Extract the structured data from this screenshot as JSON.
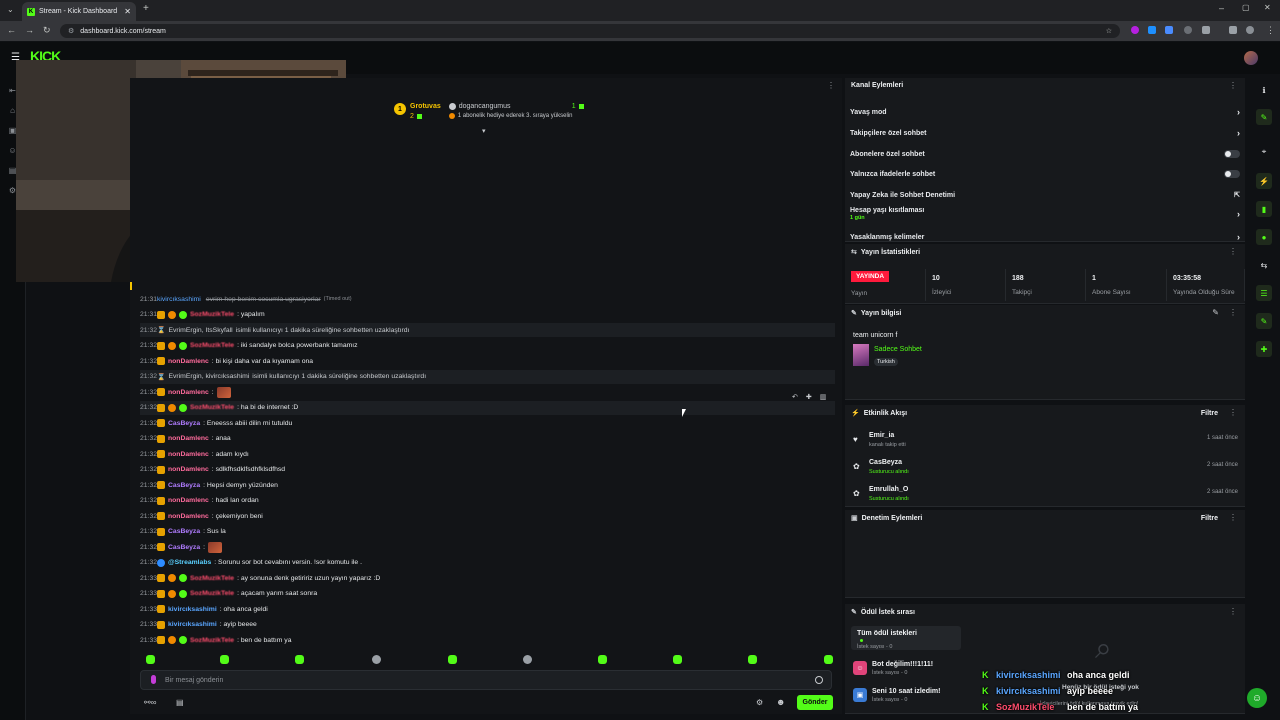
{
  "browser": {
    "tab_title": "Stream - Kick Dashboard",
    "url": "dashboard.kick.com/stream"
  },
  "app": {
    "logo": "KICK"
  },
  "top_chatter": {
    "rank": "1",
    "name": "Grotuvas",
    "count": "2",
    "second_name": "dogancangumus",
    "second_count": "1",
    "note": "1 abonelik hediye ederek 3. sıraya yükselin"
  },
  "chat": {
    "messages": [
      {
        "time": "21:31",
        "user": "kivircıksashimi",
        "text": "evrim hep benim cocumla ugrasiyorlar",
        "suffix": "(Timed out)",
        "kind": "struck"
      },
      {
        "time": "21:31",
        "user": "SozMuzikTele",
        "text": ": yapalım",
        "kind": "msg"
      },
      {
        "time": "21:32",
        "user": "EvrimErgin, ItsSkyfall",
        "text": " isimli kullanıcıyı 1 dakika süreliğine sohbetten uzaklaştırdı",
        "kind": "sys"
      },
      {
        "time": "21:32",
        "user": "SozMuzikTele",
        "text": ": iki sandalye bolca powerbank tamamız",
        "kind": "msg"
      },
      {
        "time": "21:32",
        "user": "nonDamlenc",
        "text": ": bi kişi daha var da kıyamam ona",
        "kind": "msg"
      },
      {
        "time": "21:32",
        "user": "EvrimErgin, kivircıksashimi",
        "text": " isimli kullanıcıyı 1 dakika süreliğine sohbetten uzaklaştırdı",
        "kind": "sys"
      },
      {
        "time": "21:32",
        "user": "nonDamlenc",
        "text": ":",
        "kind": "emote"
      },
      {
        "time": "21:32",
        "user": "SozMuzikTele",
        "text": ": ha bi de internet :D",
        "kind": "msg"
      },
      {
        "time": "21:32",
        "user": "CasBeyza",
        "text": ": Eneesss abiii dilin mi tutuldu",
        "kind": "msg"
      },
      {
        "time": "21:32",
        "user": "nonDamlenc",
        "text": ": anaa",
        "kind": "msg"
      },
      {
        "time": "21:32",
        "user": "nonDamlenc",
        "text": ": adam kıydı",
        "kind": "msg"
      },
      {
        "time": "21:32",
        "user": "nonDamlenc",
        "text": ": sdlkfhsdklfsdhfklsdfhsd",
        "kind": "msg"
      },
      {
        "time": "21:32",
        "user": "CasBeyza",
        "text": ": Hepsi demyn yüzünden",
        "kind": "msg"
      },
      {
        "time": "21:32",
        "user": "nonDamlenc",
        "text": ": hadi lan ordan",
        "kind": "msg"
      },
      {
        "time": "21:32",
        "user": "nonDamlenc",
        "text": ": çekemiyon beni",
        "kind": "msg"
      },
      {
        "time": "21:32",
        "user": "CasBeyza",
        "text": ": Sus la",
        "kind": "msg"
      },
      {
        "time": "21:32",
        "user": "CasBeyza",
        "text": ":",
        "kind": "emote"
      },
      {
        "time": "21:32",
        "user": "@Streamlabs",
        "text": ": Sorunu sor bot cevabını versin. !sor komutu ile .",
        "kind": "msg"
      },
      {
        "time": "21:33",
        "user": "SozMuzikTele",
        "text": ": ay sonuna denk getiririz uzun yayın yaparız :D",
        "kind": "msg"
      },
      {
        "time": "21:33",
        "user": "SozMuzikTele",
        "text": ": açacam yarım saat sonra",
        "kind": "msg"
      },
      {
        "time": "21:33",
        "user": "kivircıksashimi",
        "text": ": oha anca geldi",
        "kind": "msg"
      },
      {
        "time": "21:33",
        "user": "kivircıksashimi",
        "text": ": ayip beeee",
        "kind": "msg"
      },
      {
        "time": "21:33",
        "user": "SozMuzikTele",
        "text": ": ben de battım ya",
        "kind": "msg"
      }
    ],
    "input_placeholder": "Bir mesaj gönderin",
    "send_label": "Gönder"
  },
  "channel_actions": {
    "title": "Kanal Eylemleri",
    "items": [
      {
        "label": "Yavaş mod",
        "control": "chevron"
      },
      {
        "label": "Takipçilere özel sohbet",
        "control": "chevron"
      },
      {
        "label": "Abonelere özel sohbet",
        "control": "toggle"
      },
      {
        "label": "Yalnızca ifadelerle sohbet",
        "control": "toggle"
      },
      {
        "label": "Yapay Zeka ile Sohbet Denetimi",
        "control": "external"
      },
      {
        "label": "Hesap yaşı kısıtlaması",
        "sub": "1 gün",
        "control": "chevron"
      },
      {
        "label": "Yasaklanmış kelimeler",
        "control": "chevron"
      }
    ]
  },
  "stream_stats": {
    "title": "Yayın İstatistikleri",
    "live_badge": "YAYINDA",
    "items": [
      {
        "label": "Yayın",
        "value": ""
      },
      {
        "label": "İzleyici",
        "value": "10"
      },
      {
        "label": "Takipçi",
        "value": "188"
      },
      {
        "label": "Abone Sayısı",
        "value": "1"
      },
      {
        "label": "Yayında Olduğu Süre",
        "value": "03:35:58"
      }
    ]
  },
  "stream_info": {
    "title": "Yayın bilgisi",
    "stream_title": "team unicorn f",
    "category": "Sadece Sohbet",
    "language": "Turkish"
  },
  "activity_feed": {
    "title": "Etkinlik Akışı",
    "filter_label": "Filtre",
    "items": [
      {
        "name": "Emir_ia",
        "detail": "kanalı takip etti",
        "time": "1 saat önce",
        "icon": "heart-icon"
      },
      {
        "name": "CasBeyza",
        "detail": "Susturucu alındı",
        "time": "2 saat önce",
        "icon": "gift-icon"
      },
      {
        "name": "Emrullah_O",
        "detail": "Susturucu alındı",
        "time": "2 saat önce",
        "icon": "gift-icon"
      }
    ]
  },
  "mod_actions": {
    "title": "Denetim Eylemleri",
    "filter_label": "Filtre"
  },
  "rewards": {
    "title": "Ödül İstek sırası",
    "items": [
      {
        "name": "Tüm ödül istekleri",
        "sub": "İstek sayısı - 0"
      },
      {
        "name": "Bot değilim!!!1!11!",
        "sub": "İstek sayısı - 0"
      },
      {
        "name": "Seni 10 saat izledim!",
        "sub": "İstek sayısı - 0"
      }
    ],
    "empty_title": "Henüz bir ödül isteği yok",
    "empty_sub": "İzleyicilerini ödül kullanmaya teşvik edin!"
  },
  "overlay_chat": [
    {
      "user": "kivircıksashimi",
      "text": "oha anca geldi"
    },
    {
      "user": "kivircıksashimi",
      "text": "ayip beeee"
    },
    {
      "user": "SozMuzikTele",
      "text": "ben de battım ya"
    }
  ],
  "colors": {
    "brand": "#53fc18",
    "live": "#ff1a3c",
    "bg": "#0f1114",
    "panel": "#17191c"
  }
}
